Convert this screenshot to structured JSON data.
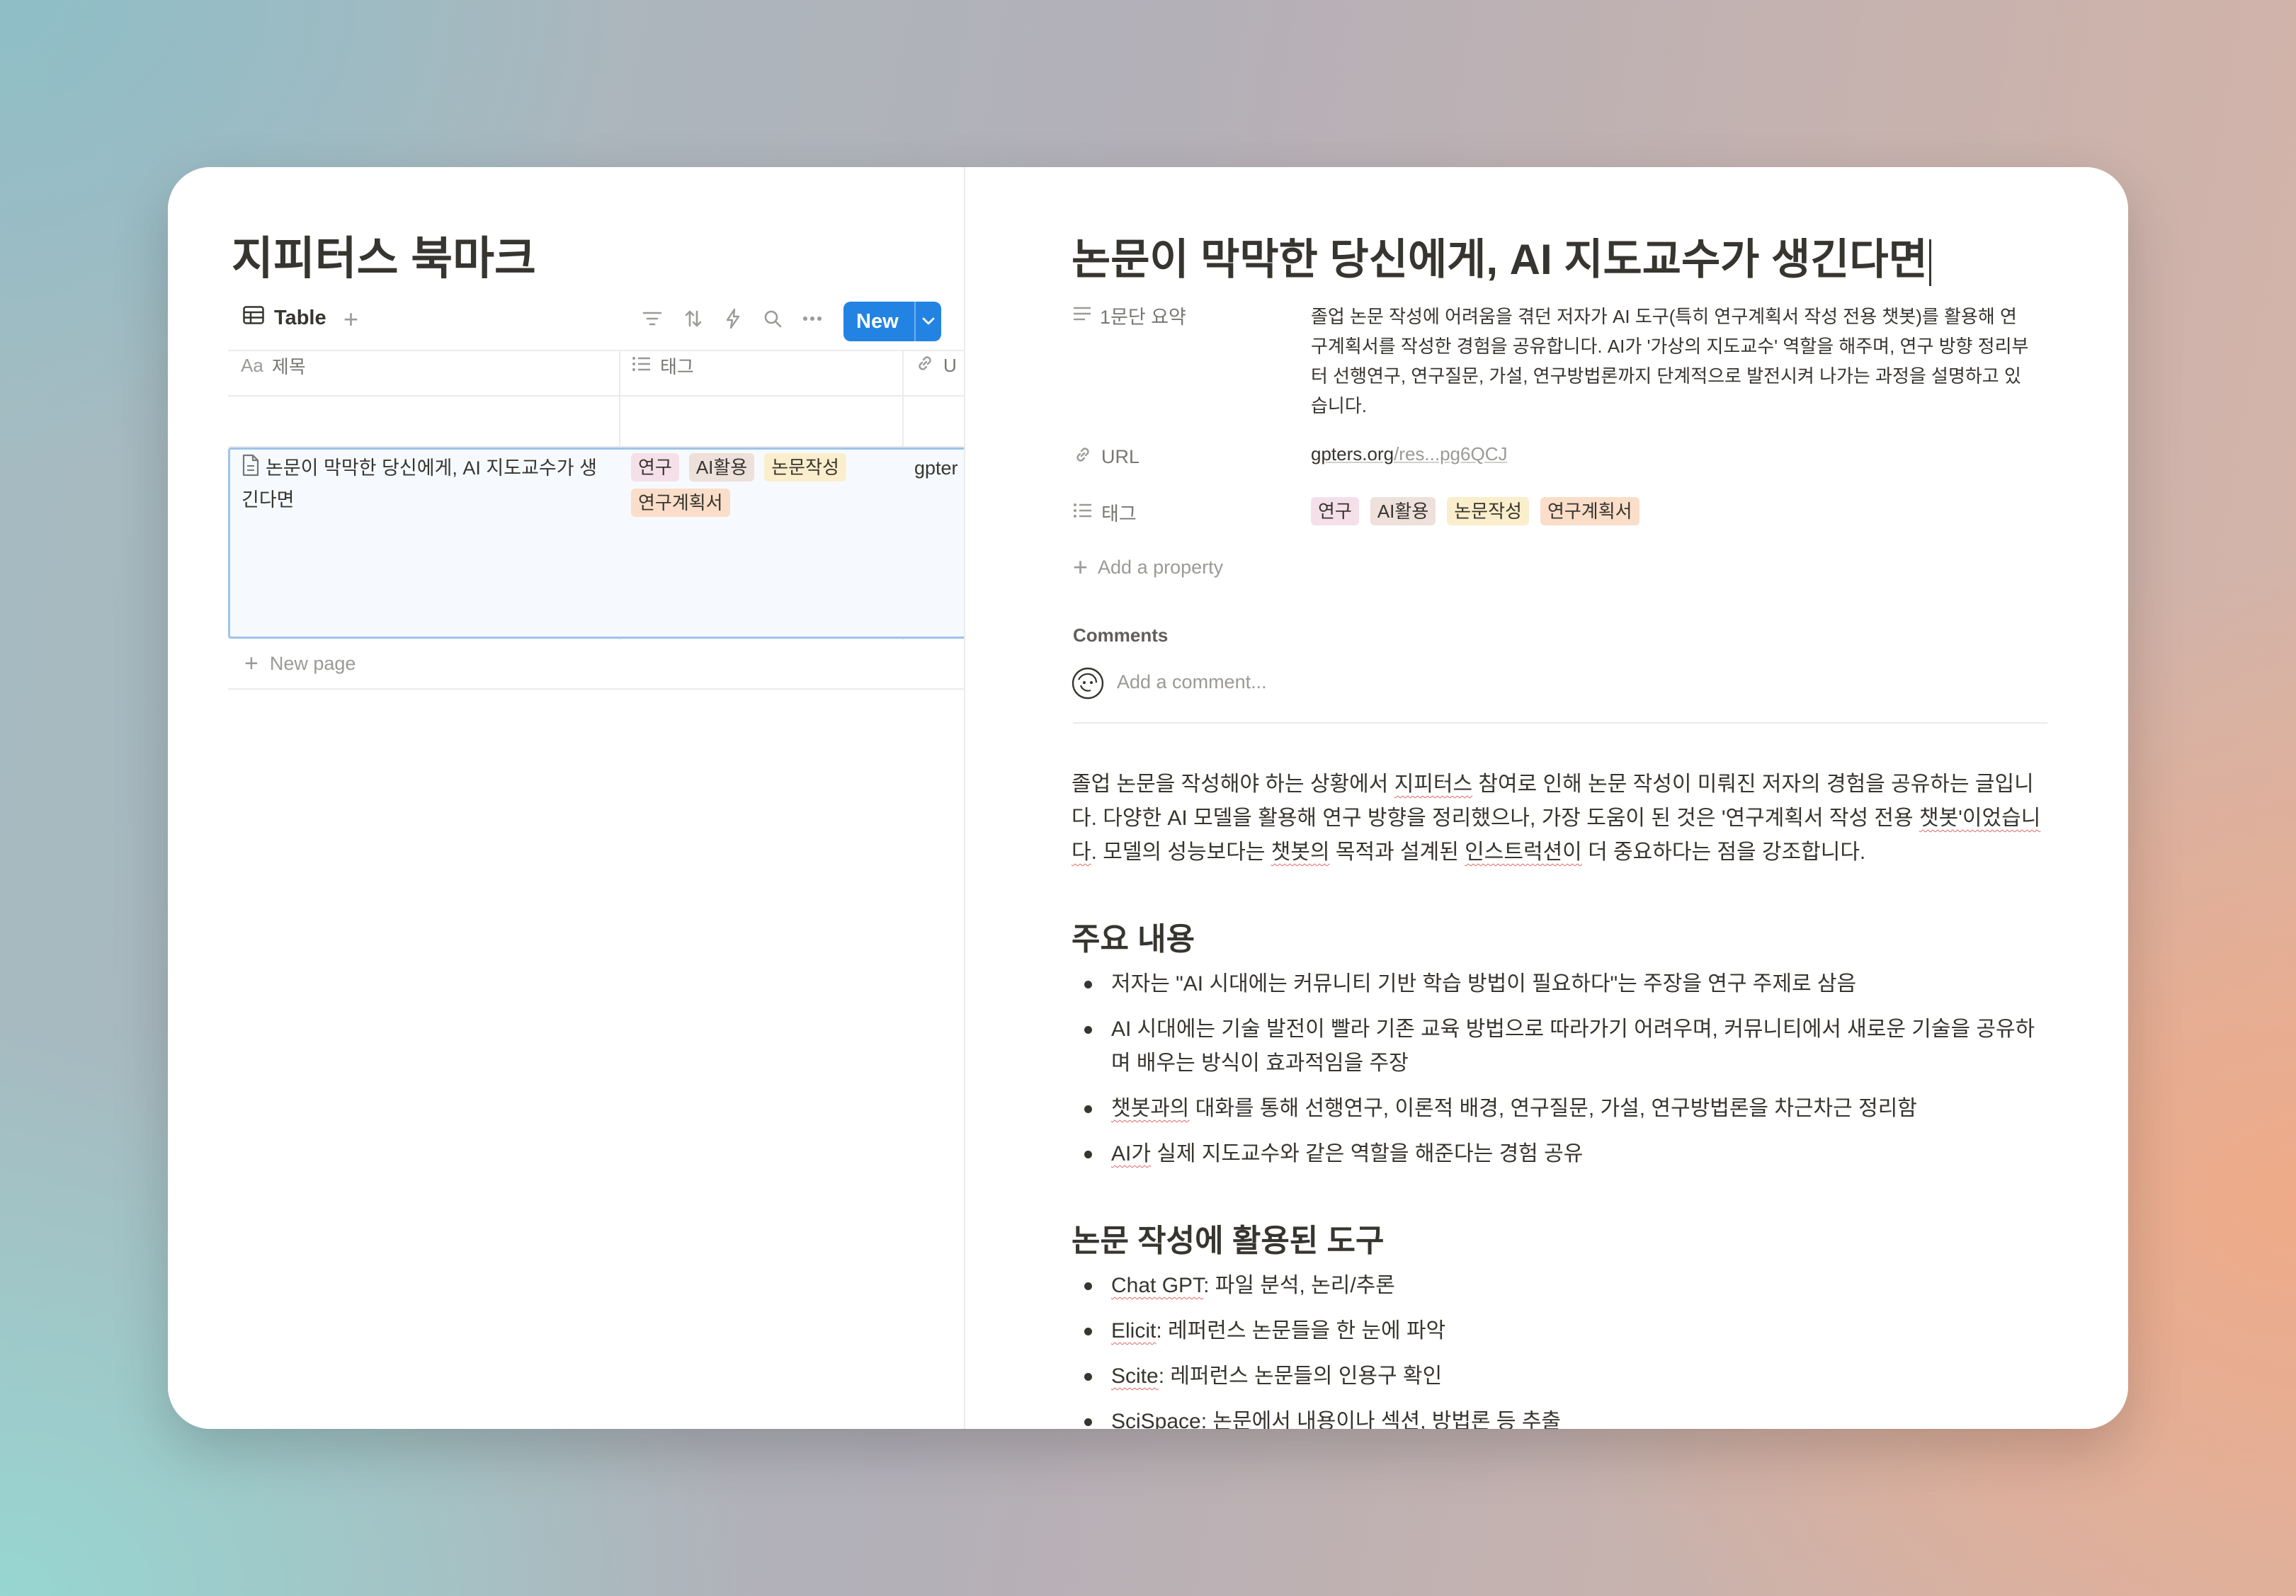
{
  "colors": {
    "accent": "#2383e2",
    "tag_pink": "#f5e0e9",
    "tag_brown": "#eee0da",
    "tag_yellow": "#fbeecc",
    "tag_orange": "#fadec9"
  },
  "database": {
    "title": "지피터스 북마크",
    "view_tab": "Table",
    "new_button": "New",
    "columns": {
      "title": "제목",
      "tags": "태그",
      "url": "U"
    },
    "row": {
      "title": "논문이 막막한 당신에게, AI 지도교수가 생긴다면",
      "tags": [
        "연구",
        "AI활용",
        "논문작성",
        "연구계획서"
      ],
      "url": "gpter"
    },
    "new_page": "New page"
  },
  "page": {
    "title": "논문이 막막한 당신에게, AI 지도교수가 생긴다면",
    "properties": {
      "summary_label": "1문단 요약",
      "summary_value": "졸업 논문 작성에 어려움을 겪던 저자가 AI 도구(특히 연구계획서 작성 전용 챗봇)를 활용해 연구계획서를 작성한 경험을 공유합니다. AI가 '가상의 지도교수' 역할을 해주며, 연구 방향 정리부터 선행연구, 연구질문, 가설, 연구방법론까지 단계적으로 발전시켜 나가는 과정을 설명하고 있습니다.",
      "url_label": "URL",
      "url_host": "gpters.org",
      "url_rest": "/res...pg6QCJ",
      "tags_label": "태그",
      "tags": [
        "연구",
        "AI활용",
        "논문작성",
        "연구계획서"
      ],
      "add_property": "Add a property"
    },
    "comments_label": "Comments",
    "comment_placeholder": "Add a comment...",
    "body": {
      "paragraph": {
        "p1": "졸업 논문을 작성해야 하는 상황에서 ",
        "p2": "지피터스",
        "p3": " 참여로 인해 논문 작성이 미뤄진 저자의 경험을 공유하는 글입니다. 다양한 AI 모델을 활용해 연구 방향을 정리했으나, 가장 도움이 된 것은 '연구계획서 작성 전용 ",
        "p4": "챗봇'이었습니다",
        "p5": ". 모델의 성능보다는 ",
        "p6": "챗봇의",
        "p7": " 목적과 설계된 ",
        "p8": "인스트럭션이",
        "p9": " 더 중요하다는 점을 강조합니다."
      },
      "heading1": "주요 내용",
      "main_points": [
        "저자는 \"AI 시대에는 커뮤니티 기반 학습 방법이 필요하다\"는 주장을 연구 주제로 삼음",
        "AI 시대에는 기술 발전이 빨라 기존 교육 방법으로 따라가기 어려우며, 커뮤니티에서 새로운 기술을 공유하며 배우는 방식이 효과적임을 주장",
        "챗봇과의 대화를 통해 선행연구, 이론적 배경, 연구질문, 가설, 연구방법론을 차근차근 정리함",
        "AI가 실제 지도교수와 같은 역할을 해준다는 경험 공유"
      ],
      "heading2": "논문 작성에 활용된 도구",
      "tools": [
        {
          "name": "Chat GPT",
          "desc": ": 파일 분석, 논리/추론"
        },
        {
          "name": "Elicit",
          "desc": ": 레퍼런스 논문들을 한 눈에 파악"
        },
        {
          "name": "Scite",
          "desc": ": 레퍼런스 논문들의 인용구 확인"
        },
        {
          "name": "SciSpace",
          "desc": ": 논문에서 내용이나 섹션, 방법론 등 추출"
        }
      ]
    }
  }
}
